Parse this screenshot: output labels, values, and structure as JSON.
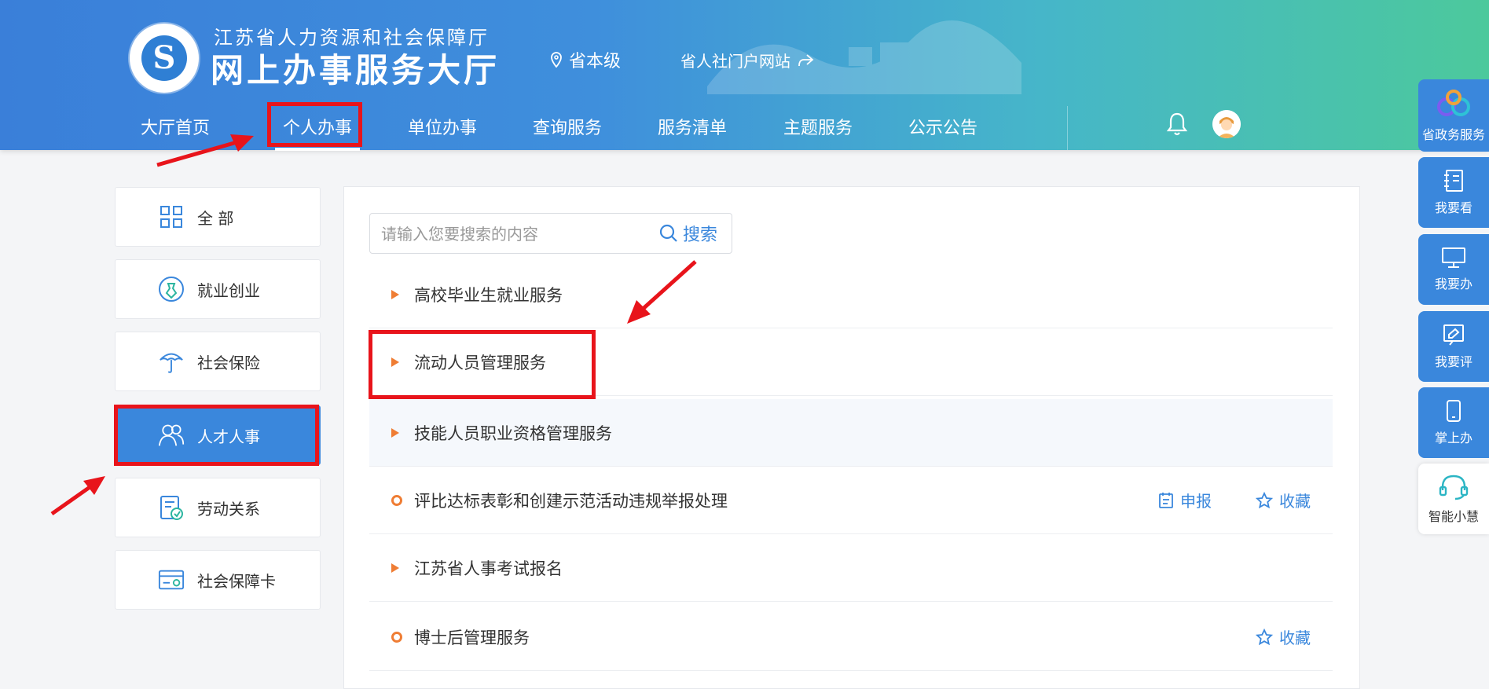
{
  "header": {
    "title_top": "江苏省人力资源和社会保障厅",
    "title_main": "网上办事服务大厅",
    "level": "省本级",
    "portal_link": "省人社门户网站"
  },
  "nav": {
    "items": [
      "大厅首页",
      "个人办事",
      "单位办事",
      "查询服务",
      "服务清单",
      "主题服务",
      "公示公告"
    ],
    "active": "个人办事"
  },
  "sidebar": {
    "items": [
      "全 部",
      "就业创业",
      "社会保险",
      "人才人事",
      "劳动关系",
      "社会保障卡"
    ],
    "active": "人才人事"
  },
  "search": {
    "placeholder": "请输入您要搜索的内容",
    "button_label": "搜索"
  },
  "services": [
    {
      "label": "高校毕业生就业服务"
    },
    {
      "label": "流动人员管理服务"
    },
    {
      "label": "技能人员职业资格管理服务"
    },
    {
      "label": "评比达标表彰和创建示范活动违规举报处理",
      "apply": "申报",
      "favorite": "收藏"
    },
    {
      "label": "江苏省人事考试报名"
    },
    {
      "label": "博士后管理服务",
      "favorite": "收藏"
    }
  ],
  "right_rail": [
    "省政务服务",
    "我要看",
    "我要办",
    "我要评",
    "掌上办",
    "智能小慧"
  ],
  "colors": {
    "accent": "#3a87dc",
    "marker": "#ef7d34",
    "annotation": "#e8141b"
  }
}
